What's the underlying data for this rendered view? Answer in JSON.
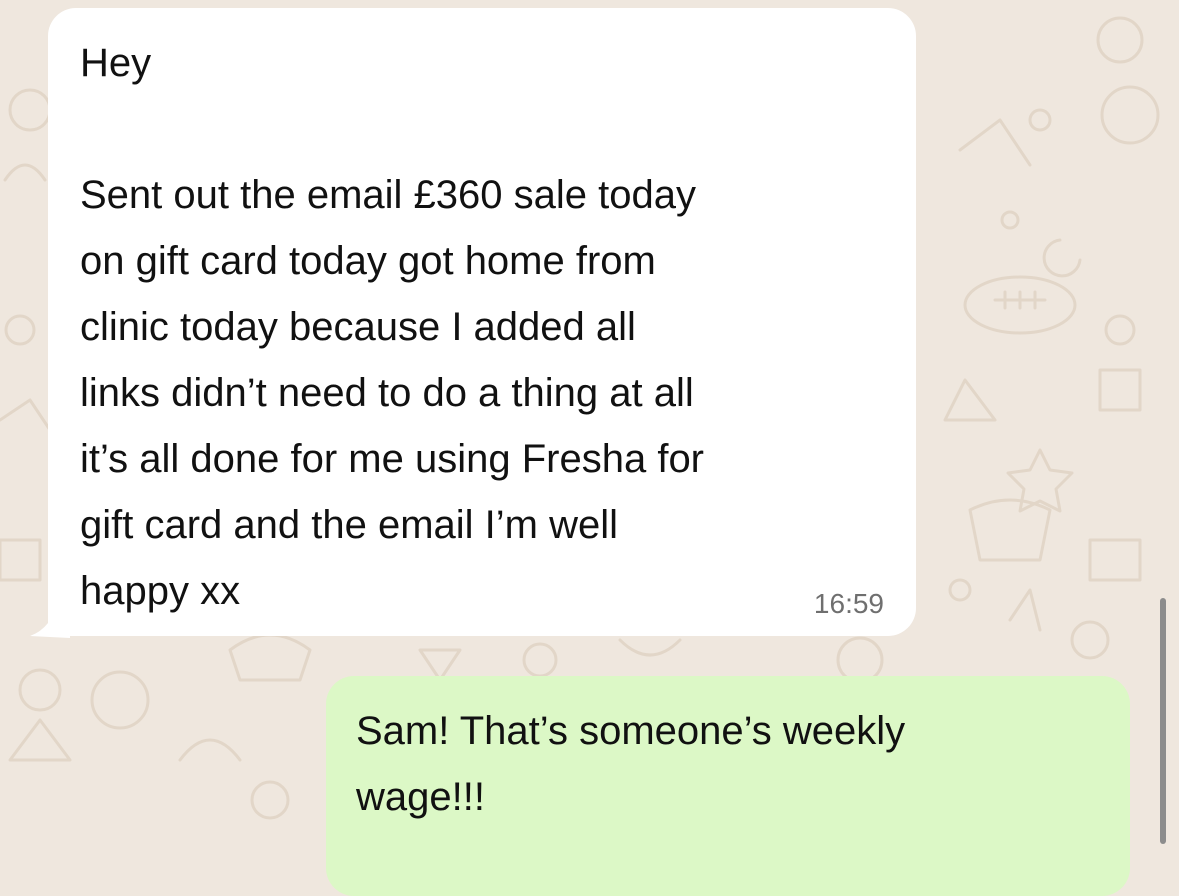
{
  "chat": {
    "incoming_message": {
      "lines": [
        "Hey",
        "",
        "Sent out the email £360 sale today",
        "on gift card today got home from",
        "clinic today because I added all",
        "links didn’t need to do a thing at all",
        "it’s all done for me using Fresha for",
        "gift card and the email I’m well",
        "happy xx"
      ],
      "time": "16:59"
    },
    "outgoing_message": {
      "lines": [
        "Sam! That’s someone’s weekly",
        "wage!!!"
      ]
    }
  },
  "colors": {
    "wallpaper": "#efe7de",
    "incoming_bubble": "#ffffff",
    "outgoing_bubble": "#dcf8c6",
    "timestamp": "#6f6f6f"
  }
}
